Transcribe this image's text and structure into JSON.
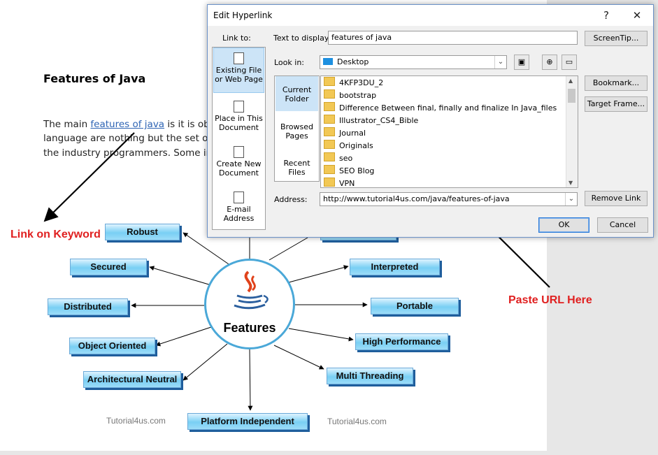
{
  "document": {
    "heading": "Features of Java",
    "para_line1_before": "The main ",
    "para_link": "features of java",
    "para_line1_after": " is it is obje",
    "para_line2": "language are nothing but the set of",
    "para_line3": "the industry programmers. Some im",
    "annotation_left": "Link on Keyword",
    "annotation_right": "Paste URL Here",
    "watermark_left": "Tutorial4us.com",
    "watermark_right": "Tutorial4us.com"
  },
  "diagram": {
    "center_label": "Features",
    "features": [
      "Robust",
      "Secured",
      "Distributed",
      "Object Oriented",
      "Architectural Neutral",
      "Platform Independent",
      "Multi Threading",
      "High Performance",
      "Portable",
      "Interpreted"
    ],
    "colors": {
      "box_fill": "#79cff4",
      "box_shadow": "#1f5e9c",
      "circle_border": "#4aa8d8",
      "annotation": "#e02020"
    }
  },
  "dialog": {
    "title": "Edit Hyperlink",
    "help_glyph": "?",
    "close_glyph": "✕",
    "link_to_label": "Link to:",
    "text_to_display_label": "Text to display:",
    "text_to_display_value": "features of java",
    "screentip_button": "ScreenTip...",
    "look_in_label": "Look in:",
    "look_in_value": "Desktop",
    "link_to_items": [
      "Existing File or Web Page",
      "Place in This Document",
      "Create New Document",
      "E-mail Address"
    ],
    "nav_items": [
      "Current Folder",
      "Browsed Pages",
      "Recent Files"
    ],
    "files": [
      "4KFP3DU_2",
      "bootstrap",
      "Difference Between final, finally and finalize In Java_files",
      "Illustrator_CS4_Bible",
      "Journal",
      "Originals",
      "seo",
      "SEO Blog",
      "VPN"
    ],
    "bookmark_button": "Bookmark...",
    "target_frame_button": "Target Frame...",
    "address_label": "Address:",
    "address_value": "http://www.tutorial4us.com/java/features-of-java",
    "remove_link_button": "Remove Link",
    "ok_button": "OK",
    "cancel_button": "Cancel"
  }
}
